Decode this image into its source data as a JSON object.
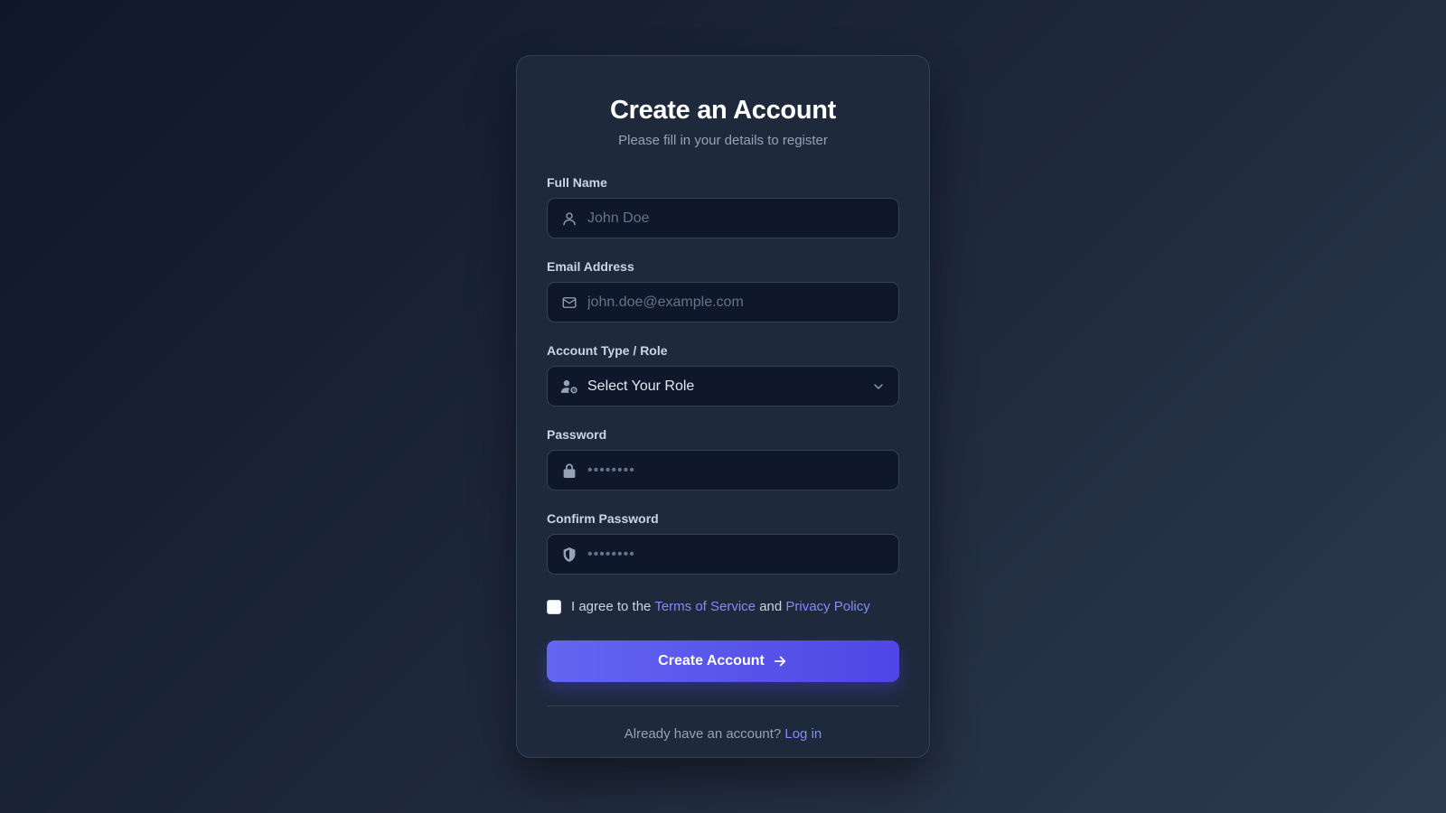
{
  "form": {
    "title": "Create an Account",
    "subtitle": "Please fill in your details to register",
    "full_name": {
      "label": "Full Name",
      "placeholder": "John Doe",
      "icon": "user-icon"
    },
    "email": {
      "label": "Email Address",
      "placeholder": "john.doe@example.com",
      "icon": "mail-icon"
    },
    "role": {
      "label": "Account Type / Role",
      "value": "Select Your Role",
      "icon": "user-gear-icon"
    },
    "password": {
      "label": "Password",
      "placeholder": "••••••••",
      "icon": "lock-icon"
    },
    "confirm_password": {
      "label": "Confirm Password",
      "placeholder": "••••••••",
      "icon": "shield-icon"
    },
    "agree": {
      "prefix": "I agree to the",
      "terms_link": "Terms of Service",
      "conjunction": "and",
      "privacy_link": "Privacy Policy",
      "checked": false
    },
    "submit_label": "Create Account",
    "footer": {
      "prompt": "Already have an account?",
      "login_link": "Log in"
    }
  },
  "colors": {
    "accent": "#6366f1",
    "accent_dark": "#4f46e5",
    "link": "#818cf8",
    "card_bg": "#1e293b",
    "input_bg": "#0f172a"
  }
}
